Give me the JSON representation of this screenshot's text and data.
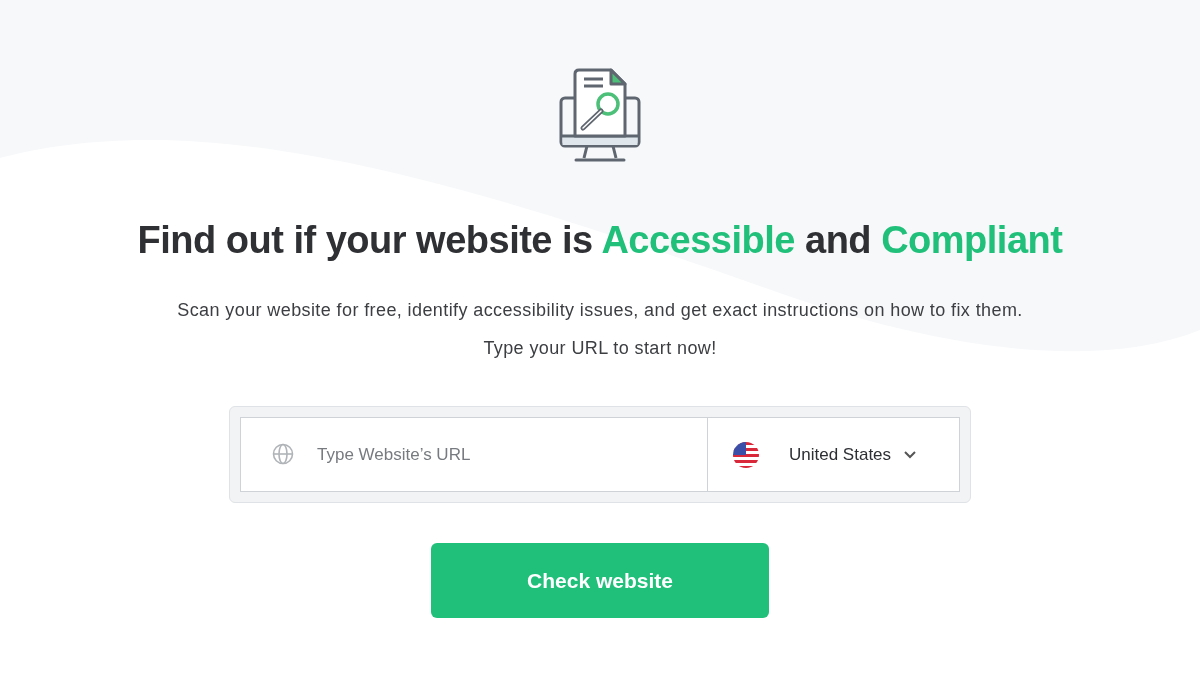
{
  "heading": [
    {
      "text": "Find out if your website is ",
      "highlight": false
    },
    {
      "text": "Accessible",
      "highlight": true
    },
    {
      "text": " and ",
      "highlight": false
    },
    {
      "text": "Compliant",
      "highlight": true
    }
  ],
  "description": "Scan your website for free, identify accessibility issues, and get exact instructions on how to fix them. Type your URL to start now!",
  "url_field": {
    "placeholder": "Type Website’s URL"
  },
  "country_select": {
    "value": "United States"
  },
  "submit_button": "Check website"
}
